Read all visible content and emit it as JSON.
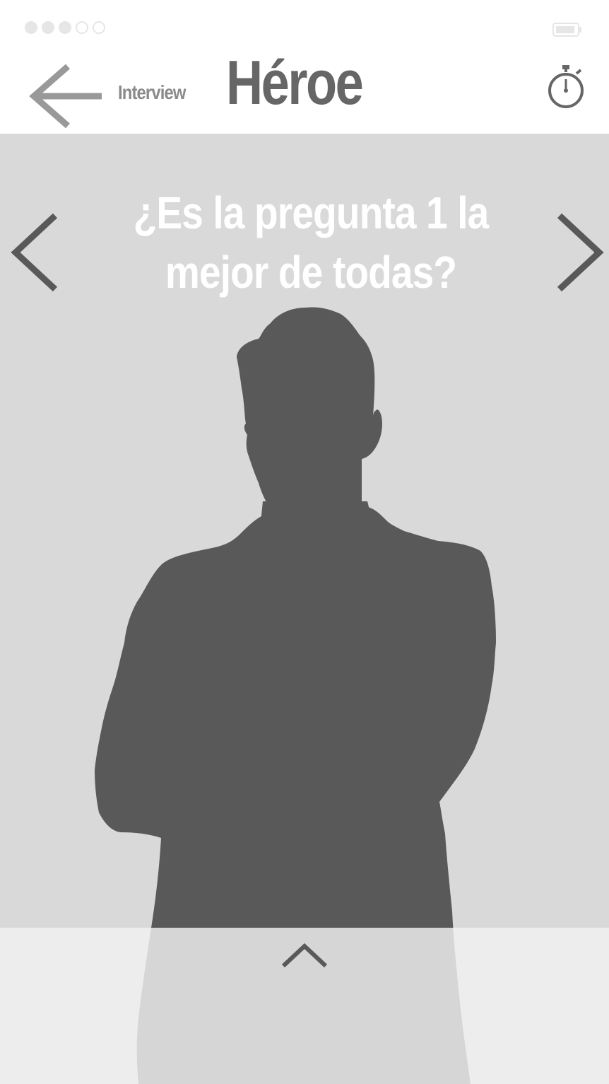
{
  "status_bar": {
    "signal_dots": [
      "filled",
      "filled",
      "filled",
      "empty",
      "empty"
    ],
    "battery_icon": "battery-icon"
  },
  "header": {
    "back_icon": "arrow-left-icon",
    "back_label": "Interview",
    "title": "Héroe",
    "timer_icon": "stopwatch-icon"
  },
  "main": {
    "question": "¿Es la pregunta 1 la mejor de todas?",
    "prev_icon": "chevron-left-icon",
    "next_icon": "chevron-right-icon",
    "image": "person-silhouette",
    "expand_icon": "chevron-up-icon"
  },
  "colors": {
    "background": "#d9d9d9",
    "silhouette": "#595959",
    "title": "#666666",
    "muted": "#8a8a8a",
    "question_text": "#ffffff",
    "bottom_panel": "#f2f2f2"
  }
}
